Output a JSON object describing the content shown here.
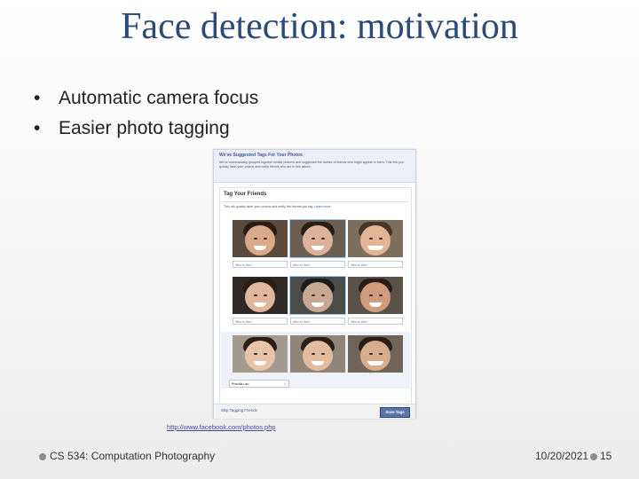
{
  "slide": {
    "title": "Face detection: motivation",
    "bullets": [
      "Automatic camera focus",
      "Easier photo tagging"
    ]
  },
  "screenshot": {
    "header_title": "We've Suggested Tags For Your Photos",
    "header_text": "We've automatically grouped together similar pictures and suggested the names of friends who might appear in them. This lets you quickly label your photos and notify friends who are in this album.",
    "panel_title": "Tag Your Friends",
    "panel_subtitle": "This will quickly label your photos and notify the friends you tag.",
    "learn_more": "Learn more",
    "who_placeholder": "Who is this?",
    "tagged_name": "Priscilla Lau",
    "tagged_remove": "x",
    "skip_label": "Skip Tagging Friends",
    "save_label": "Save Tags"
  },
  "source_url": "http://www.facebook.com/photos.php",
  "footer": {
    "course": "CS 534: Computation Photography",
    "date": "10/20/2021",
    "page": "15"
  }
}
